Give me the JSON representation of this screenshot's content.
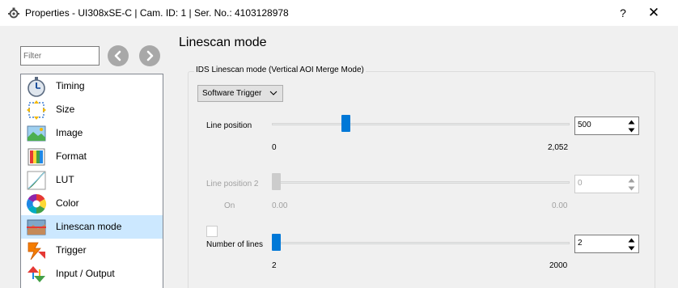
{
  "window": {
    "title": "Properties - UI308xSE-C | Cam. ID: 1 | Ser. No.: 4103128978",
    "help_label": "?",
    "close_label": "✕"
  },
  "filter": {
    "placeholder": "Filter"
  },
  "tree": {
    "items": [
      {
        "label": "Timing",
        "icon": "stopwatch-icon"
      },
      {
        "label": "Size",
        "icon": "resize-icon"
      },
      {
        "label": "Image",
        "icon": "image-icon"
      },
      {
        "label": "Format",
        "icon": "format-icon"
      },
      {
        "label": "LUT",
        "icon": "lut-curve-icon"
      },
      {
        "label": "Color",
        "icon": "color-wheel-icon"
      },
      {
        "label": "Linescan mode",
        "icon": "linescan-icon",
        "selected": true
      },
      {
        "label": "Trigger",
        "icon": "trigger-icon"
      },
      {
        "label": "Input / Output",
        "icon": "input-output-icon"
      }
    ]
  },
  "page": {
    "title": "Linescan mode",
    "group_title": "IDS Linescan mode (Vertical AOI Merge Mode)",
    "mode_combo": {
      "value": "Software Trigger"
    },
    "line_position": {
      "label": "Line position",
      "min_label": "0",
      "max_label": "2,052",
      "value": "500",
      "min": 0,
      "max": 2052,
      "current": 500
    },
    "line_position_2": {
      "label": "Line position 2",
      "min_label": "0.00",
      "max_label": "0.00",
      "value": "0",
      "enabled": false,
      "on_label": "On"
    },
    "number_of_lines": {
      "label": "Number of lines",
      "min_label": "2",
      "max_label": "2000",
      "value": "2",
      "min": 2,
      "max": 2000,
      "current": 2
    }
  },
  "colors": {
    "accent": "#0078d7",
    "selection": "#cce8ff"
  }
}
